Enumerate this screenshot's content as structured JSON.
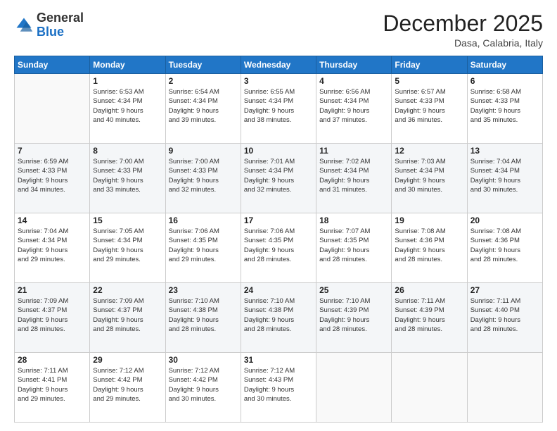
{
  "header": {
    "logo_general": "General",
    "logo_blue": "Blue",
    "month": "December 2025",
    "location": "Dasa, Calabria, Italy"
  },
  "days_of_week": [
    "Sunday",
    "Monday",
    "Tuesday",
    "Wednesday",
    "Thursday",
    "Friday",
    "Saturday"
  ],
  "weeks": [
    [
      {
        "day": "",
        "info": ""
      },
      {
        "day": "1",
        "info": "Sunrise: 6:53 AM\nSunset: 4:34 PM\nDaylight: 9 hours\nand 40 minutes."
      },
      {
        "day": "2",
        "info": "Sunrise: 6:54 AM\nSunset: 4:34 PM\nDaylight: 9 hours\nand 39 minutes."
      },
      {
        "day": "3",
        "info": "Sunrise: 6:55 AM\nSunset: 4:34 PM\nDaylight: 9 hours\nand 38 minutes."
      },
      {
        "day": "4",
        "info": "Sunrise: 6:56 AM\nSunset: 4:34 PM\nDaylight: 9 hours\nand 37 minutes."
      },
      {
        "day": "5",
        "info": "Sunrise: 6:57 AM\nSunset: 4:33 PM\nDaylight: 9 hours\nand 36 minutes."
      },
      {
        "day": "6",
        "info": "Sunrise: 6:58 AM\nSunset: 4:33 PM\nDaylight: 9 hours\nand 35 minutes."
      }
    ],
    [
      {
        "day": "7",
        "info": "Sunrise: 6:59 AM\nSunset: 4:33 PM\nDaylight: 9 hours\nand 34 minutes."
      },
      {
        "day": "8",
        "info": "Sunrise: 7:00 AM\nSunset: 4:33 PM\nDaylight: 9 hours\nand 33 minutes."
      },
      {
        "day": "9",
        "info": "Sunrise: 7:00 AM\nSunset: 4:33 PM\nDaylight: 9 hours\nand 32 minutes."
      },
      {
        "day": "10",
        "info": "Sunrise: 7:01 AM\nSunset: 4:34 PM\nDaylight: 9 hours\nand 32 minutes."
      },
      {
        "day": "11",
        "info": "Sunrise: 7:02 AM\nSunset: 4:34 PM\nDaylight: 9 hours\nand 31 minutes."
      },
      {
        "day": "12",
        "info": "Sunrise: 7:03 AM\nSunset: 4:34 PM\nDaylight: 9 hours\nand 30 minutes."
      },
      {
        "day": "13",
        "info": "Sunrise: 7:04 AM\nSunset: 4:34 PM\nDaylight: 9 hours\nand 30 minutes."
      }
    ],
    [
      {
        "day": "14",
        "info": "Sunrise: 7:04 AM\nSunset: 4:34 PM\nDaylight: 9 hours\nand 29 minutes."
      },
      {
        "day": "15",
        "info": "Sunrise: 7:05 AM\nSunset: 4:34 PM\nDaylight: 9 hours\nand 29 minutes."
      },
      {
        "day": "16",
        "info": "Sunrise: 7:06 AM\nSunset: 4:35 PM\nDaylight: 9 hours\nand 29 minutes."
      },
      {
        "day": "17",
        "info": "Sunrise: 7:06 AM\nSunset: 4:35 PM\nDaylight: 9 hours\nand 28 minutes."
      },
      {
        "day": "18",
        "info": "Sunrise: 7:07 AM\nSunset: 4:35 PM\nDaylight: 9 hours\nand 28 minutes."
      },
      {
        "day": "19",
        "info": "Sunrise: 7:08 AM\nSunset: 4:36 PM\nDaylight: 9 hours\nand 28 minutes."
      },
      {
        "day": "20",
        "info": "Sunrise: 7:08 AM\nSunset: 4:36 PM\nDaylight: 9 hours\nand 28 minutes."
      }
    ],
    [
      {
        "day": "21",
        "info": "Sunrise: 7:09 AM\nSunset: 4:37 PM\nDaylight: 9 hours\nand 28 minutes."
      },
      {
        "day": "22",
        "info": "Sunrise: 7:09 AM\nSunset: 4:37 PM\nDaylight: 9 hours\nand 28 minutes."
      },
      {
        "day": "23",
        "info": "Sunrise: 7:10 AM\nSunset: 4:38 PM\nDaylight: 9 hours\nand 28 minutes."
      },
      {
        "day": "24",
        "info": "Sunrise: 7:10 AM\nSunset: 4:38 PM\nDaylight: 9 hours\nand 28 minutes."
      },
      {
        "day": "25",
        "info": "Sunrise: 7:10 AM\nSunset: 4:39 PM\nDaylight: 9 hours\nand 28 minutes."
      },
      {
        "day": "26",
        "info": "Sunrise: 7:11 AM\nSunset: 4:39 PM\nDaylight: 9 hours\nand 28 minutes."
      },
      {
        "day": "27",
        "info": "Sunrise: 7:11 AM\nSunset: 4:40 PM\nDaylight: 9 hours\nand 28 minutes."
      }
    ],
    [
      {
        "day": "28",
        "info": "Sunrise: 7:11 AM\nSunset: 4:41 PM\nDaylight: 9 hours\nand 29 minutes."
      },
      {
        "day": "29",
        "info": "Sunrise: 7:12 AM\nSunset: 4:42 PM\nDaylight: 9 hours\nand 29 minutes."
      },
      {
        "day": "30",
        "info": "Sunrise: 7:12 AM\nSunset: 4:42 PM\nDaylight: 9 hours\nand 30 minutes."
      },
      {
        "day": "31",
        "info": "Sunrise: 7:12 AM\nSunset: 4:43 PM\nDaylight: 9 hours\nand 30 minutes."
      },
      {
        "day": "",
        "info": ""
      },
      {
        "day": "",
        "info": ""
      },
      {
        "day": "",
        "info": ""
      }
    ]
  ]
}
